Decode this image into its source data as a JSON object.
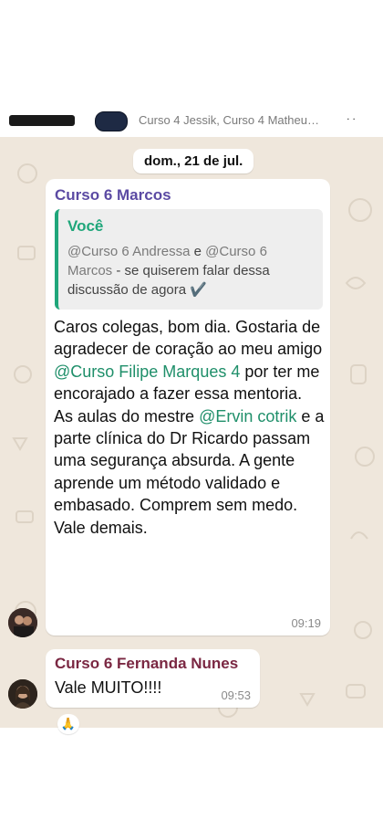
{
  "header": {
    "members": "Curso 4 Jessik, Curso 4 Matheu…",
    "status_glyph": "ᐧ ᐧ"
  },
  "date_separator": "dom., 21 de jul.",
  "messages": [
    {
      "sender": "Curso 6 Marcos",
      "sender_color": "#5b4aa3",
      "quote": {
        "author": "Você",
        "mention1": "@Curso 6 Andressa",
        "conj": " e ",
        "mention2": "@Curso 6 Marcos",
        "text": "  - se quiserem falar dessa discussão de agora ✔️"
      },
      "body": {
        "p1": "Caros colegas, bom dia. Gostaria de agradecer de coração ao meu amigo ",
        "mention1": "@Curso Filipe Marques 4",
        "p2": "  por ter me encorajado a fazer essa mentoria.",
        "p3": "As aulas do mestre ",
        "mention2": "@Ervin cotrik",
        "p4": " e a parte clínica do Dr Ricardo passam uma segurança absurda. A gente aprende um método validado e embasado. Comprem sem medo. Vale demais."
      },
      "time": "09:19"
    },
    {
      "sender": "Curso 6 Fernanda Nunes",
      "sender_color": "#7a2742",
      "body": "Vale MUITO!!!!",
      "time": "09:53",
      "reaction": "🙏"
    }
  ]
}
